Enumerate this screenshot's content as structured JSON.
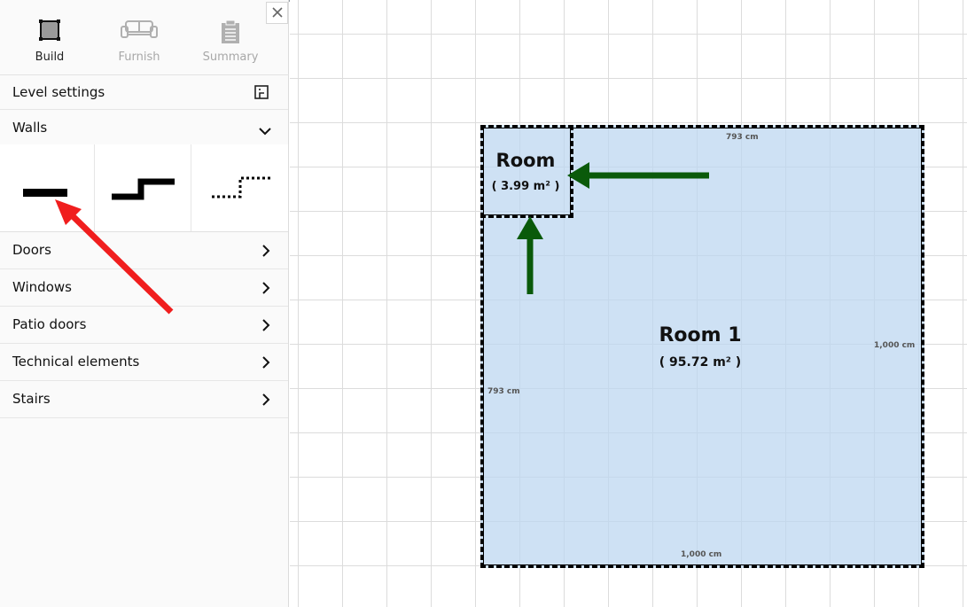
{
  "mode_tabs": [
    {
      "label": "Build",
      "icon": "square-build-icon",
      "active": true
    },
    {
      "label": "Furnish",
      "icon": "sofa-icon",
      "active": false
    },
    {
      "label": "Summary",
      "icon": "clipboard-icon",
      "active": false
    }
  ],
  "close_icon": "close-icon",
  "rows": {
    "level_settings": {
      "label": "Level settings",
      "icon": "level-plan-icon"
    },
    "walls": {
      "label": "Walls",
      "icon": "chevron-down-icon"
    },
    "doors": {
      "label": "Doors",
      "icon": "chevron-right-icon"
    },
    "windows": {
      "label": "Windows",
      "icon": "chevron-right-icon"
    },
    "patio_doors": {
      "label": "Patio doors",
      "icon": "chevron-right-icon"
    },
    "technical_elements": {
      "label": "Technical elements",
      "icon": "chevron-right-icon"
    },
    "stairs": {
      "label": "Stairs",
      "icon": "chevron-right-icon"
    }
  },
  "wall_tools": [
    {
      "icon": "straight-wall-icon"
    },
    {
      "icon": "stepped-wall-icon"
    },
    {
      "icon": "dotted-wall-icon"
    }
  ],
  "plan": {
    "room1": {
      "name": "Room 1",
      "area": "( 95.72 m² )"
    },
    "room_small": {
      "name": "Room",
      "area": "( 3.99 m² )"
    },
    "dims": {
      "top": "793 cm",
      "right": "1,000 cm",
      "left": "793 cm",
      "bottom": "1,000 cm"
    }
  },
  "colors": {
    "room_fill": "#bed7f0",
    "red_arrow": "#f01e1e",
    "green_arrow": "#0a5a0a"
  }
}
